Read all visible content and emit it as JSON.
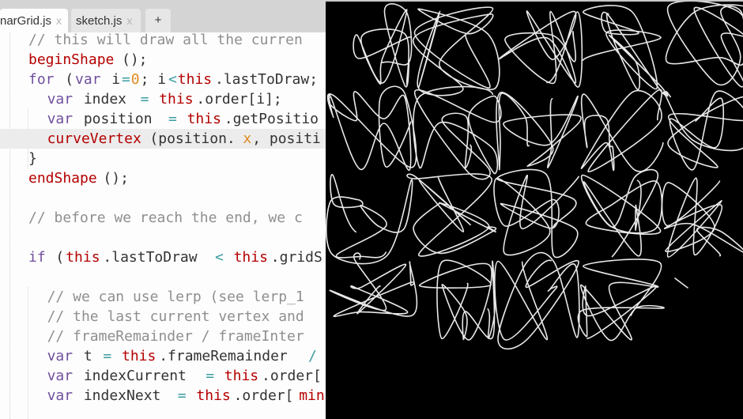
{
  "tabs": [
    {
      "label": "narGrid.js",
      "close": "x",
      "active": true
    },
    {
      "label": "sketch.js",
      "close": "x",
      "active": false
    },
    {
      "label": "+",
      "active": false
    }
  ],
  "code_lines": [
    [
      {
        "c": "com",
        "t": "// this will draw all the curren"
      }
    ],
    [
      {
        "c": "red",
        "t": "beginShape"
      },
      {
        "c": "txt",
        "t": "();"
      }
    ],
    [
      {
        "c": "kw",
        "t": "for"
      },
      {
        "c": "txt",
        "t": " ("
      },
      {
        "c": "kw",
        "t": "var"
      },
      {
        "c": "txt",
        "t": " i"
      },
      {
        "c": "op",
        "t": "="
      },
      {
        "c": "num",
        "t": "0"
      },
      {
        "c": "txt",
        "t": "; i"
      },
      {
        "c": "op",
        "t": "<"
      },
      {
        "c": "red",
        "t": "this"
      },
      {
        "c": "txt",
        "t": ".lastToDraw;"
      }
    ],
    [
      {
        "c": "txt",
        "t": "  "
      },
      {
        "c": "kw",
        "t": "var"
      },
      {
        "c": "txt",
        "t": " index "
      },
      {
        "c": "op",
        "t": "="
      },
      {
        "c": "txt",
        "t": " "
      },
      {
        "c": "red",
        "t": "this"
      },
      {
        "c": "txt",
        "t": ".order[i];"
      }
    ],
    [
      {
        "c": "txt",
        "t": "  "
      },
      {
        "c": "kw",
        "t": "var"
      },
      {
        "c": "txt",
        "t": " position "
      },
      {
        "c": "op",
        "t": "="
      },
      {
        "c": "txt",
        "t": " "
      },
      {
        "c": "red",
        "t": "this"
      },
      {
        "c": "txt",
        "t": ".getPositio"
      }
    ],
    [
      {
        "c": "txt",
        "t": "  "
      },
      {
        "c": "red",
        "t": "curveVertex"
      },
      {
        "c": "txt",
        "t": "(position."
      },
      {
        "c": "num",
        "t": "x"
      },
      {
        "c": "txt",
        "t": ", positi"
      }
    ],
    [
      {
        "c": "txt",
        "t": "}"
      }
    ],
    [
      {
        "c": "red",
        "t": "endShape"
      },
      {
        "c": "txt",
        "t": "();"
      }
    ],
    [],
    [
      {
        "c": "com",
        "t": "// before we reach the end, we c"
      }
    ],
    [],
    [
      {
        "c": "kw",
        "t": "if"
      },
      {
        "c": "txt",
        "t": " ("
      },
      {
        "c": "red",
        "t": "this"
      },
      {
        "c": "txt",
        "t": ".lastToDraw "
      },
      {
        "c": "op",
        "t": "<"
      },
      {
        "c": "txt",
        "t": " "
      },
      {
        "c": "red",
        "t": "this"
      },
      {
        "c": "txt",
        "t": ".gridS"
      }
    ],
    [],
    [
      {
        "c": "txt",
        "t": "  "
      },
      {
        "c": "com",
        "t": "// we can use lerp (see lerp_1"
      }
    ],
    [
      {
        "c": "txt",
        "t": "  "
      },
      {
        "c": "com",
        "t": "// the last current vertex and"
      }
    ],
    [
      {
        "c": "txt",
        "t": "  "
      },
      {
        "c": "com",
        "t": "// frameRemainder / frameInter"
      }
    ],
    [
      {
        "c": "txt",
        "t": "  "
      },
      {
        "c": "kw",
        "t": "var"
      },
      {
        "c": "txt",
        "t": " t "
      },
      {
        "c": "op",
        "t": "="
      },
      {
        "c": "txt",
        "t": " "
      },
      {
        "c": "red",
        "t": "this"
      },
      {
        "c": "txt",
        "t": ".frameRemainder "
      },
      {
        "c": "op",
        "t": "/"
      }
    ],
    [
      {
        "c": "txt",
        "t": "  "
      },
      {
        "c": "kw",
        "t": "var"
      },
      {
        "c": "txt",
        "t": " indexCurrent "
      },
      {
        "c": "op",
        "t": "="
      },
      {
        "c": "txt",
        "t": " "
      },
      {
        "c": "red",
        "t": "this"
      },
      {
        "c": "txt",
        "t": ".order["
      }
    ],
    [
      {
        "c": "txt",
        "t": "  "
      },
      {
        "c": "kw",
        "t": "var"
      },
      {
        "c": "txt",
        "t": " indexNext "
      },
      {
        "c": "op",
        "t": "="
      },
      {
        "c": "txt",
        "t": " "
      },
      {
        "c": "red",
        "t": "this"
      },
      {
        "c": "txt",
        "t": ".order["
      },
      {
        "c": "red",
        "t": "min"
      }
    ],
    []
  ],
  "highlighted_line": 5,
  "canvas": {
    "background": "#000000",
    "stroke": "#e8e8e8",
    "grid_columns": 5,
    "grid_rows": 4,
    "complete_shapes": 19,
    "partial_shape_index": 19
  },
  "colors": {
    "comment": "#8f8f8f",
    "keyword": "#704f9e",
    "this_func": "#b40000",
    "number": "#e08a1e",
    "operator": "#3b9da1"
  }
}
